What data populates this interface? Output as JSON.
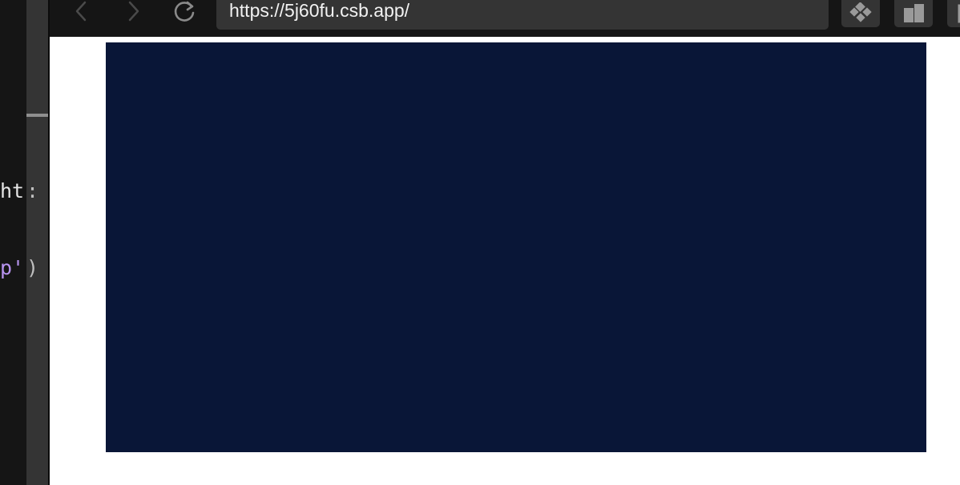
{
  "editor": {
    "line1": "ht",
    "line1_overflow": ":",
    "line2_string": "p'",
    "line2_overflow": ")"
  },
  "browser": {
    "url": "https://5j60fu.csb.app/",
    "toolbar_icons": [
      "chevron-left-icon",
      "chevron-right-icon",
      "reload-icon",
      "devtools-icon",
      "split-view-icon",
      "new-window-icon"
    ]
  },
  "preview": {
    "canvas_color": "#091637"
  }
}
